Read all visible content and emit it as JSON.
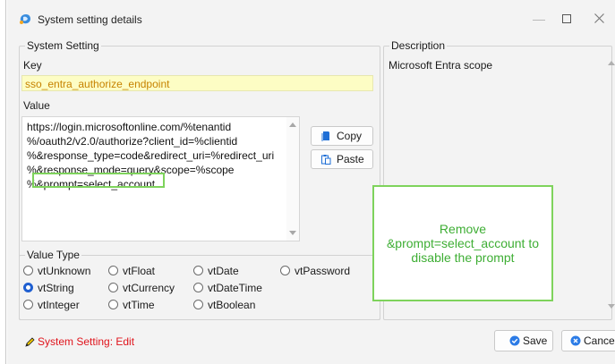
{
  "window": {
    "title": "System setting details",
    "icon": "app-icon"
  },
  "system_setting": {
    "group_label": "System Setting",
    "key_label": "Key",
    "key_value": "sso_entra_authorize_endpoint",
    "value_label": "Value",
    "value_lines": [
      "https://login.microsoftonline.com/%tenantid",
      "%/oauth2/v2.0/authorize?client_id=%clientid",
      "%&response_type=code&redirect_uri=%redirect_uri",
      "%&response_mode=query&scope=%scope",
      "%&prompt=select_account"
    ],
    "copy_label": "Copy",
    "paste_label": "Paste"
  },
  "value_type": {
    "group_label": "Value Type",
    "options": [
      {
        "label": "vtUnknown",
        "selected": false
      },
      {
        "label": "vtFloat",
        "selected": false
      },
      {
        "label": "vtDate",
        "selected": false
      },
      {
        "label": "vtPassword",
        "selected": false
      },
      {
        "label": "vtString",
        "selected": true
      },
      {
        "label": "vtCurrency",
        "selected": false
      },
      {
        "label": "vtDateTime",
        "selected": false
      },
      {
        "label": "vtInteger",
        "selected": false
      },
      {
        "label": "vtTime",
        "selected": false
      },
      {
        "label": "vtBoolean",
        "selected": false
      }
    ]
  },
  "description": {
    "group_label": "Description",
    "text": "Microsoft Entra scope"
  },
  "annotation": {
    "lines": [
      "Remove",
      "&prompt=select_account to",
      "disable the prompt"
    ],
    "color": "#3eae34"
  },
  "footer": {
    "status_text": "System Setting: Edit",
    "save_label": "Save",
    "cancel_label": "Cancel"
  },
  "colors": {
    "key_bg": "#fdfdc4",
    "key_text": "#c78200",
    "highlight_border": "#7ed35c",
    "status_text": "#e0141c",
    "radio_selected": "#1f5fd1"
  }
}
